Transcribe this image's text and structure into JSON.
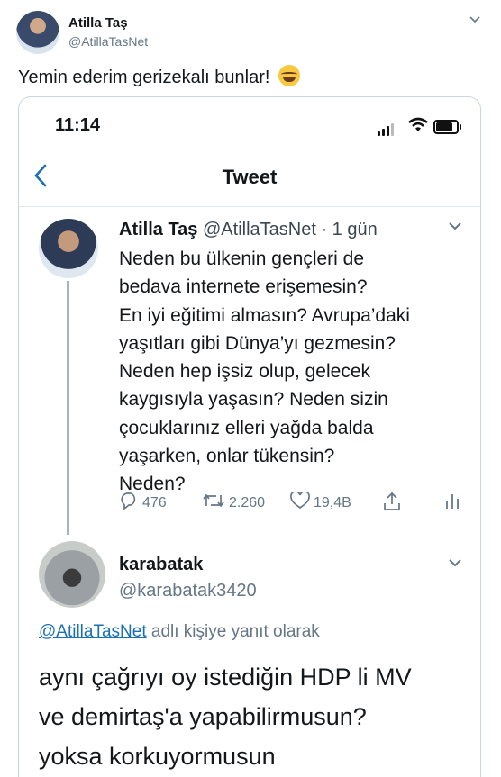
{
  "outer_tweet": {
    "name": "Atilla Taş",
    "handle": "@AtillaTasNet",
    "text": "Yemin ederim gerizekalı bunlar!",
    "emoji": "crying-laughing-emoji",
    "menu_icon": "chevron-down-icon"
  },
  "screenshot": {
    "status_bar": {
      "time": "11:14",
      "icons": [
        "signal-icon",
        "wifi-icon",
        "battery-icon"
      ]
    },
    "nav": {
      "back_icon": "chevron-left-icon",
      "title": "Tweet"
    },
    "tweet1": {
      "name": "Atilla Taş",
      "meta": "@AtillaTasNet · 1 gün",
      "lines": [
        "Neden bu ülkenin gençleri de",
        "bedava internete erişemesin?",
        "En iyi eğitimi almasın? Avrupa’daki",
        "yaşıtları gibi Dünya’yı gezmesin?",
        "Neden hep işsiz olup, gelecek",
        "kaygısıyla yaşasın? Neden sizin",
        "çocuklarınız elleri yağda balda",
        "yaşarken, onlar tükensin?",
        "Neden?"
      ],
      "replies": "476",
      "retweets": "2.260",
      "likes": "19,4B",
      "action_icons": [
        "reply-icon",
        "retweet-icon",
        "like-icon",
        "share-icon",
        "analytics-icon"
      ]
    },
    "tweet2": {
      "name": "karabatak",
      "handle": "@karabatak3420",
      "reply_mention": "@AtillaTasNet",
      "reply_suffix": " adlı kişiye yanıt olarak",
      "lines": [
        "aynı çağrıyı oy istediğin HDP li MV",
        "ve demirtaş'a yapabilirmusun?",
        "yoksa korkuyormusun"
      ]
    }
  },
  "colors": {
    "text": "#14171a",
    "secondary": "#657786",
    "link": "#1b6fb5",
    "thread_line": "#a6b5c4",
    "border": "#ccd6dd"
  }
}
